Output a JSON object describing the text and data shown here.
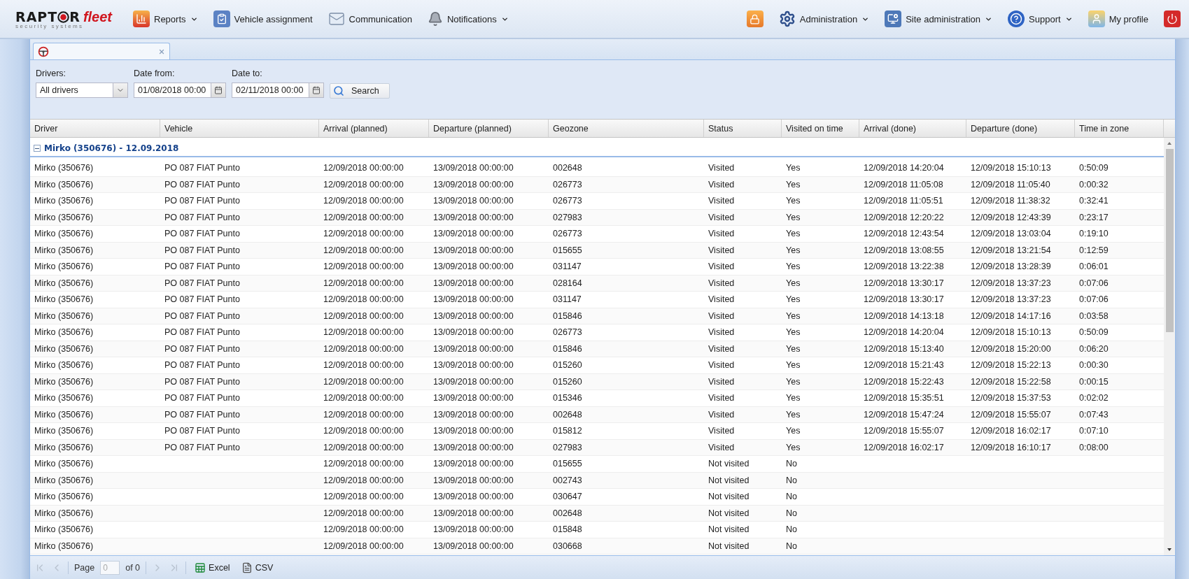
{
  "logo": {
    "left": "RAPT",
    "right": "R",
    "suffix": "fleet",
    "tagline": "security systems"
  },
  "menu_left": [
    {
      "label": "Reports",
      "dropdown": true
    },
    {
      "label": "Vehicle assignment",
      "dropdown": false
    },
    {
      "label": "Communication",
      "dropdown": false
    },
    {
      "label": "Notifications",
      "dropdown": true
    }
  ],
  "menu_right": [
    {
      "dropdown": false
    },
    {
      "label": "Administration",
      "dropdown": true
    },
    {
      "label": "Site administration",
      "dropdown": true
    },
    {
      "label": "Support",
      "dropdown": true
    },
    {
      "label": "My profile",
      "dropdown": false
    },
    {
      "dropdown": false
    }
  ],
  "tabs": [
    {
      "selected": true
    }
  ],
  "filters": {
    "drivers": {
      "label": "Drivers:",
      "value": "All drivers"
    },
    "date_from": {
      "label": "Date from:",
      "value": "01/08/2018 00:00"
    },
    "date_to": {
      "label": "Date to:",
      "value": "02/11/2018 00:00"
    },
    "search_button": "Search"
  },
  "table": {
    "columns": [
      "Driver",
      "Vehicle",
      "Arrival (planned)",
      "Departure (planned)",
      "Geozone",
      "Status",
      "Visited on time",
      "Arrival (done)",
      "Departure (done)",
      "Time in zone"
    ],
    "group": {
      "label": "Mirko (350676) - 12.09.2018",
      "expanded": true
    },
    "rows": [
      [
        "Mirko  (350676)",
        "PO 087  FIAT Punto",
        "12/09/2018 00:00:00",
        "13/09/2018 00:00:00",
        "002648",
        "Visited",
        "Yes",
        "12/09/2018 14:20:04",
        "12/09/2018 15:10:13",
        "0:50:09"
      ],
      [
        "Mirko  (350676)",
        "PO 087  FIAT Punto",
        "12/09/2018 00:00:00",
        "13/09/2018 00:00:00",
        "026773",
        "Visited",
        "Yes",
        "12/09/2018 11:05:08",
        "12/09/2018 11:05:40",
        "0:00:32"
      ],
      [
        "Mirko  (350676)",
        "PO 087  FIAT Punto",
        "12/09/2018 00:00:00",
        "13/09/2018 00:00:00",
        "026773",
        "Visited",
        "Yes",
        "12/09/2018 11:05:51",
        "12/09/2018 11:38:32",
        "0:32:41"
      ],
      [
        "Mirko  (350676)",
        "PO 087  FIAT Punto",
        "12/09/2018 00:00:00",
        "13/09/2018 00:00:00",
        "027983",
        "Visited",
        "Yes",
        "12/09/2018 12:20:22",
        "12/09/2018 12:43:39",
        "0:23:17"
      ],
      [
        "Mirko  (350676)",
        "PO 087  FIAT Punto",
        "12/09/2018 00:00:00",
        "13/09/2018 00:00:00",
        "026773",
        "Visited",
        "Yes",
        "12/09/2018 12:43:54",
        "12/09/2018 13:03:04",
        "0:19:10"
      ],
      [
        "Mirko  (350676)",
        "PO 087  FIAT Punto",
        "12/09/2018 00:00:00",
        "13/09/2018 00:00:00",
        "015655",
        "Visited",
        "Yes",
        "12/09/2018 13:08:55",
        "12/09/2018 13:21:54",
        "0:12:59"
      ],
      [
        "Mirko  (350676)",
        "PO 087  FIAT Punto",
        "12/09/2018 00:00:00",
        "13/09/2018 00:00:00",
        "031147",
        "Visited",
        "Yes",
        "12/09/2018 13:22:38",
        "12/09/2018 13:28:39",
        "0:06:01"
      ],
      [
        "Mirko  (350676)",
        "PO 087  FIAT Punto",
        "12/09/2018 00:00:00",
        "13/09/2018 00:00:00",
        "028164",
        "Visited",
        "Yes",
        "12/09/2018 13:30:17",
        "12/09/2018 13:37:23",
        "0:07:06"
      ],
      [
        "Mirko  (350676)",
        "PO 087  FIAT Punto",
        "12/09/2018 00:00:00",
        "13/09/2018 00:00:00",
        "031147",
        "Visited",
        "Yes",
        "12/09/2018 13:30:17",
        "12/09/2018 13:37:23",
        "0:07:06"
      ],
      [
        "Mirko  (350676)",
        "PO 087  FIAT Punto",
        "12/09/2018 00:00:00",
        "13/09/2018 00:00:00",
        "015846",
        "Visited",
        "Yes",
        "12/09/2018 14:13:18",
        "12/09/2018 14:17:16",
        "0:03:58"
      ],
      [
        "Mirko  (350676)",
        "PO 087  FIAT Punto",
        "12/09/2018 00:00:00",
        "13/09/2018 00:00:00",
        "026773",
        "Visited",
        "Yes",
        "12/09/2018 14:20:04",
        "12/09/2018 15:10:13",
        "0:50:09"
      ],
      [
        "Mirko  (350676)",
        "PO 087  FIAT Punto",
        "12/09/2018 00:00:00",
        "13/09/2018 00:00:00",
        "015846",
        "Visited",
        "Yes",
        "12/09/2018 15:13:40",
        "12/09/2018 15:20:00",
        "0:06:20"
      ],
      [
        "Mirko  (350676)",
        "PO 087  FIAT Punto",
        "12/09/2018 00:00:00",
        "13/09/2018 00:00:00",
        "015260",
        "Visited",
        "Yes",
        "12/09/2018 15:21:43",
        "12/09/2018 15:22:13",
        "0:00:30"
      ],
      [
        "Mirko  (350676)",
        "PO 087  FIAT Punto",
        "12/09/2018 00:00:00",
        "13/09/2018 00:00:00",
        "015260",
        "Visited",
        "Yes",
        "12/09/2018 15:22:43",
        "12/09/2018 15:22:58",
        "0:00:15"
      ],
      [
        "Mirko  (350676)",
        "PO 087  FIAT Punto",
        "12/09/2018 00:00:00",
        "13/09/2018 00:00:00",
        "015346",
        "Visited",
        "Yes",
        "12/09/2018 15:35:51",
        "12/09/2018 15:37:53",
        "0:02:02"
      ],
      [
        "Mirko  (350676)",
        "PO 087  FIAT Punto",
        "12/09/2018 00:00:00",
        "13/09/2018 00:00:00",
        "002648",
        "Visited",
        "Yes",
        "12/09/2018 15:47:24",
        "12/09/2018 15:55:07",
        "0:07:43"
      ],
      [
        "Mirko  (350676)",
        "PO 087  FIAT Punto",
        "12/09/2018 00:00:00",
        "13/09/2018 00:00:00",
        "015812",
        "Visited",
        "Yes",
        "12/09/2018 15:55:07",
        "12/09/2018 16:02:17",
        "0:07:10"
      ],
      [
        "Mirko  (350676)",
        "PO 087  FIAT Punto",
        "12/09/2018 00:00:00",
        "13/09/2018 00:00:00",
        "027983",
        "Visited",
        "Yes",
        "12/09/2018 16:02:17",
        "12/09/2018 16:10:17",
        "0:08:00"
      ],
      [
        "Mirko  (350676)",
        null,
        "12/09/2018 00:00:00",
        "13/09/2018 00:00:00",
        "015655",
        "Not visited",
        "No",
        null,
        null,
        null
      ],
      [
        "Mirko  (350676)",
        null,
        "12/09/2018 00:00:00",
        "13/09/2018 00:00:00",
        "002743",
        "Not visited",
        "No",
        null,
        null,
        null
      ],
      [
        "Mirko  (350676)",
        null,
        "12/09/2018 00:00:00",
        "13/09/2018 00:00:00",
        "030647",
        "Not visited",
        "No",
        null,
        null,
        null
      ],
      [
        "Mirko  (350676)",
        null,
        "12/09/2018 00:00:00",
        "13/09/2018 00:00:00",
        "002648",
        "Not visited",
        "No",
        null,
        null,
        null
      ],
      [
        "Mirko  (350676)",
        null,
        "12/09/2018 00:00:00",
        "13/09/2018 00:00:00",
        "015848",
        "Not visited",
        "No",
        null,
        null,
        null
      ],
      [
        "Mirko  (350676)",
        null,
        "12/09/2018 00:00:00",
        "13/09/2018 00:00:00",
        "030668",
        "Not visited",
        "No",
        null,
        null,
        null
      ]
    ]
  },
  "pager": {
    "page_label": "Page",
    "page_value": "0",
    "of_label": "of 0",
    "first_disabled": true,
    "prev_disabled": true,
    "next_disabled": true,
    "last_disabled": true,
    "export_buttons": [
      "Excel",
      "CSV"
    ]
  }
}
